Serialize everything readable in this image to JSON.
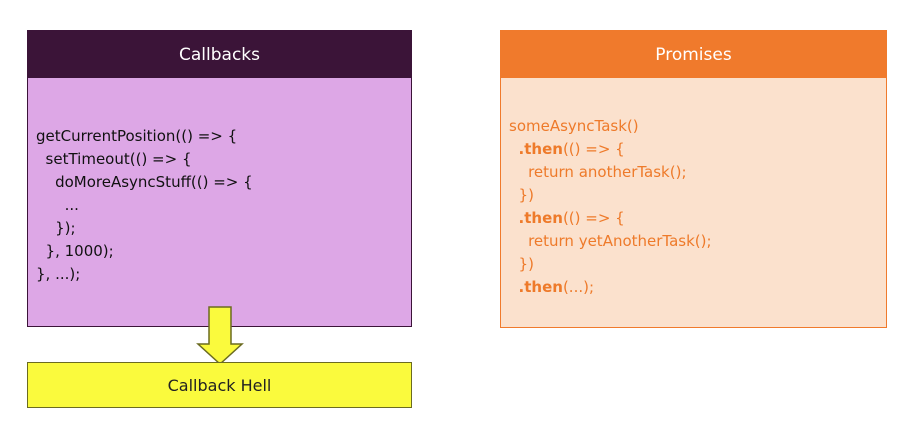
{
  "callbacks": {
    "title": "Callbacks",
    "code_lines": [
      "getCurrentPosition(() => {",
      "  setTimeout(() => {",
      "    doMoreAsyncStuff(() => {",
      "      ...",
      "    });",
      "  }, 1000);",
      "}, ...);"
    ],
    "colors": {
      "header": "#3b1438",
      "body": "#dda7e6"
    }
  },
  "promises": {
    "title": "Promises",
    "code": {
      "line1": "someAsyncTask()",
      "then_keyword": ".then",
      "line2_rest": "(() => {",
      "line3": "    return anotherTask();",
      "line4": "  })",
      "line6": "    return yetAnotherTask();",
      "line7": "  })",
      "line8_rest": "(...);"
    },
    "colors": {
      "header": "#f07a2c",
      "body": "#fbe1cd",
      "text": "#ee7a2a"
    }
  },
  "result": {
    "label": "Callback Hell",
    "color": "#fafa3d"
  }
}
